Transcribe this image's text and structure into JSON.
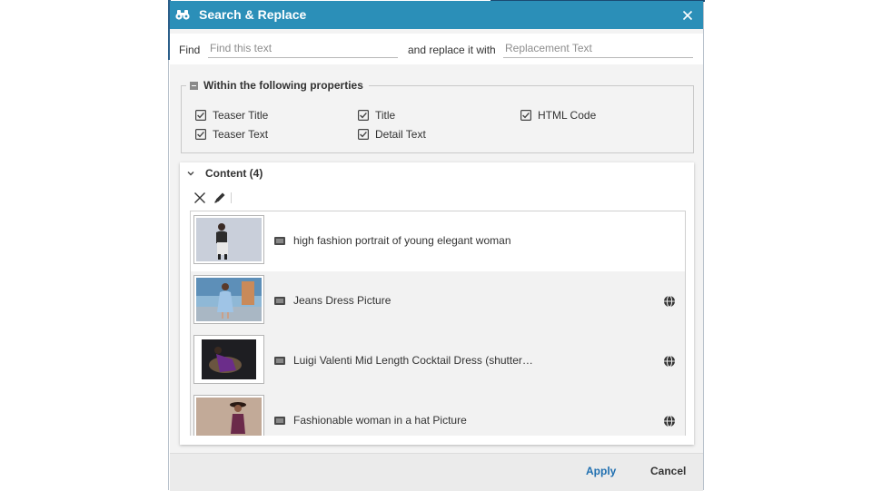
{
  "dialog": {
    "title": "Search & Replace",
    "accent_color": "#2b8fb8"
  },
  "find": {
    "find_label": "Find",
    "find_placeholder": "Find this text",
    "replace_label": "and replace it with",
    "replace_placeholder": "Replacement Text"
  },
  "properties": {
    "legend": "Within the following properties",
    "checkboxes": [
      {
        "label": "Teaser Title",
        "checked": true
      },
      {
        "label": "Teaser Text",
        "checked": true
      },
      {
        "label": "Title",
        "checked": true
      },
      {
        "label": "Detail Text",
        "checked": true
      },
      {
        "label": "HTML Code",
        "checked": true
      }
    ]
  },
  "content": {
    "header": "Content (4)",
    "toolbar": {
      "remove_icon": "close-icon",
      "edit_icon": "pencil-icon"
    },
    "items": [
      {
        "title": "high fashion portrait of young elegant woman",
        "type_icon": "picture-icon",
        "localized": false
      },
      {
        "title": "Jeans Dress Picture",
        "type_icon": "picture-icon",
        "localized": true
      },
      {
        "title": "Luigi Valenti Mid Length Cocktail Dress (shutter…",
        "type_icon": "picture-icon",
        "localized": true
      },
      {
        "title": "Fashionable woman in a hat Picture",
        "type_icon": "picture-icon",
        "localized": true
      }
    ]
  },
  "footer": {
    "apply_label": "Apply",
    "cancel_label": "Cancel",
    "apply_color": "#1f6fb0"
  }
}
